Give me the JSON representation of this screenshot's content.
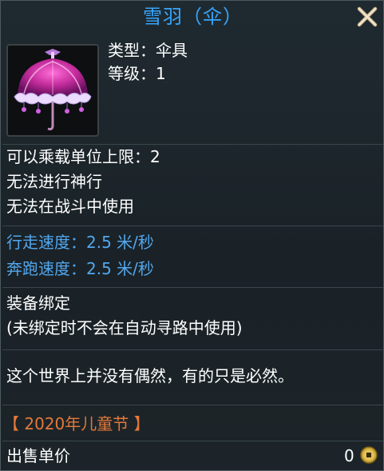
{
  "title": "雪羽（伞）",
  "icon_names": {
    "close": "close-x-icon",
    "item": "umbrella-icon",
    "coin": "coin-icon"
  },
  "colors": {
    "title": "#37a6ff",
    "speed_text": "#52a7ee",
    "event_tag": "#e4783a",
    "text": "#ffffff"
  },
  "item": {
    "type": "类型：伞具",
    "level": "等级：1"
  },
  "attributes": {
    "capacity": "可以乘载单位上限：2",
    "no_divine_travel": "无法进行神行",
    "no_battle_use": "无法在战斗中使用"
  },
  "speeds": {
    "walk": "行走速度：2.5 米/秒",
    "run": "奔跑速度：2.5 米/秒"
  },
  "binding": {
    "label": "装备绑定",
    "note": "(未绑定时不会在自动寻路中使用)"
  },
  "description": "这个世界上并没有偶然，有的只是必然。",
  "event_tag": "【 2020年儿童节 】",
  "sale": {
    "label": "出售单价",
    "price": "0"
  }
}
